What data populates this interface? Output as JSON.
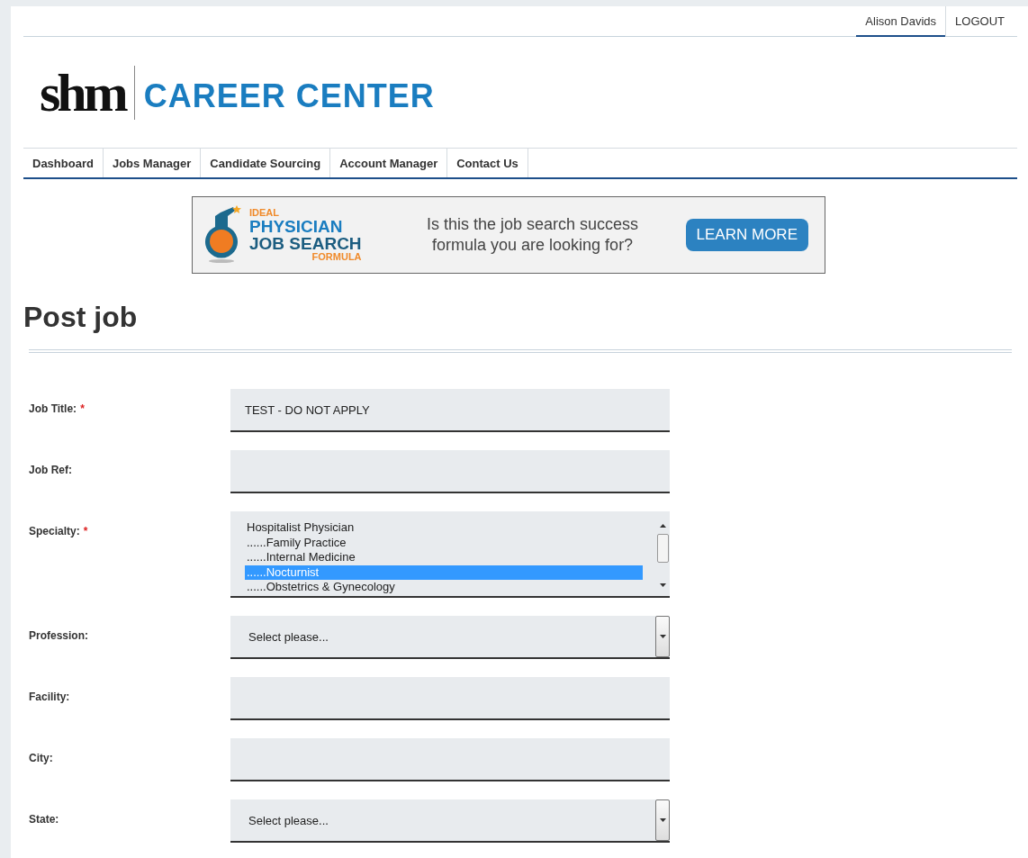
{
  "user_menu": [
    {
      "label": "Alison Davids",
      "selected": true
    },
    {
      "label": "LOGOUT",
      "selected": false
    }
  ],
  "logo": {
    "mark": "shm",
    "name": "CAREER CENTER"
  },
  "nav": [
    {
      "label": "Dashboard"
    },
    {
      "label": "Jobs Manager"
    },
    {
      "label": "Candidate Sourcing"
    },
    {
      "label": "Account Manager"
    },
    {
      "label": "Contact Us"
    }
  ],
  "banner": {
    "brand_top": "IDEAL",
    "brand_main": "PHYSICIAN",
    "brand_sub": "JOB SEARCH",
    "brand_bottom": "FORMULA",
    "message": "Is this the job search success formula you are looking for?",
    "button": "LEARN MORE"
  },
  "page_title": "Post job",
  "fields": [
    {
      "kind": "text",
      "label": "Job Title:",
      "required_mark": "*",
      "value": "TEST - DO NOT APPLY"
    },
    {
      "kind": "text",
      "label": "Job Ref:"
    },
    {
      "kind": "listbox",
      "label": "Specialty:",
      "required_mark": "*",
      "options": [
        {
          "label": "Hospitalist Physician",
          "selected": false
        },
        {
          "label": "......Family Practice",
          "selected": false
        },
        {
          "label": "......Internal Medicine",
          "selected": false
        },
        {
          "label": "......Nocturnist",
          "selected": true
        },
        {
          "label": "......Obstetrics & Gynecology",
          "selected": false
        }
      ]
    },
    {
      "kind": "select",
      "label": "Profession:",
      "value": "Select please..."
    },
    {
      "kind": "text",
      "label": "Facility:"
    },
    {
      "kind": "text",
      "label": "City:"
    },
    {
      "kind": "select",
      "label": "State:",
      "value": "Select please..."
    }
  ]
}
